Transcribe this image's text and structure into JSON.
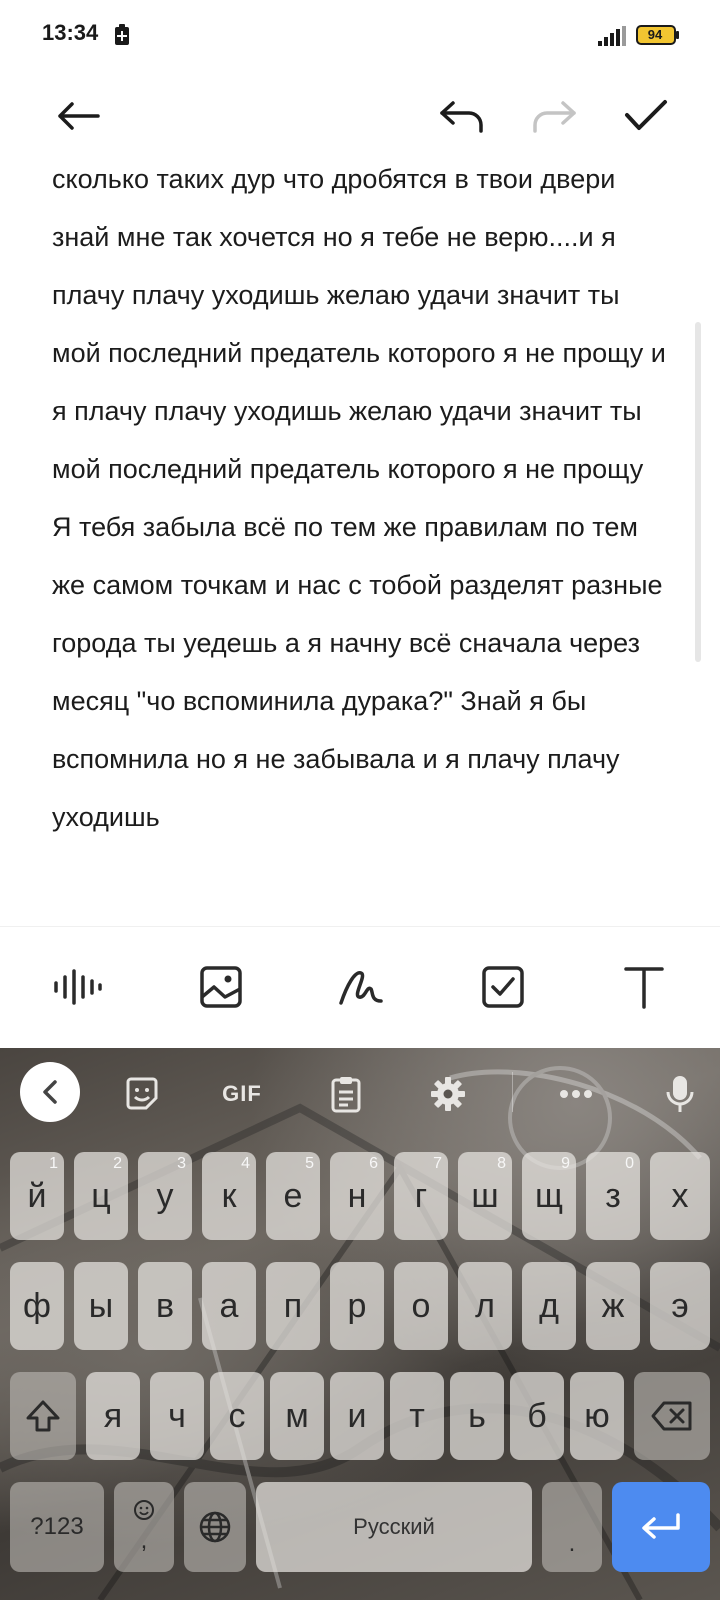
{
  "status_bar": {
    "time": "13:34",
    "battery": "94"
  },
  "note": {
    "paragraphs": [
      "сколько таких дур что дробятся в твои двери знай мне так хочется но я тебе не верю....и я плачу плачу уходишь желаю удачи значит ты мой последний предатель которого я не прощу и я плачу плачу уходишь желаю удачи значит ты мой последний предатель которого я не прощу",
      "Я тебя забыла всё по тем же правилам по тем же самом  точкам и нас с тобой разделят разные города ты уедешь а я начну всё сначала  через месяц \"чо вспоминила дурака?\" Знай я  бы вспомнила но я не забывала и я плачу плачу уходишь"
    ]
  },
  "keyboard": {
    "toolbar": {
      "gif_label": "GIF"
    },
    "row1": [
      {
        "key": "й",
        "hint": "1"
      },
      {
        "key": "ц",
        "hint": "2"
      },
      {
        "key": "у",
        "hint": "3"
      },
      {
        "key": "к",
        "hint": "4"
      },
      {
        "key": "е",
        "hint": "5"
      },
      {
        "key": "н",
        "hint": "6"
      },
      {
        "key": "г",
        "hint": "7"
      },
      {
        "key": "ш",
        "hint": "8"
      },
      {
        "key": "щ",
        "hint": "9"
      },
      {
        "key": "з",
        "hint": "0"
      },
      {
        "key": "х",
        "hint": ""
      }
    ],
    "row2": [
      "ф",
      "ы",
      "в",
      "а",
      "п",
      "р",
      "о",
      "л",
      "д",
      "ж",
      "э"
    ],
    "row3": [
      "я",
      "ч",
      "с",
      "м",
      "и",
      "т",
      "ь",
      "б",
      "ю"
    ],
    "symbols_label": "?123",
    "emoji_comma_label": ",",
    "space_label": "Русский",
    "period_label": "."
  }
}
